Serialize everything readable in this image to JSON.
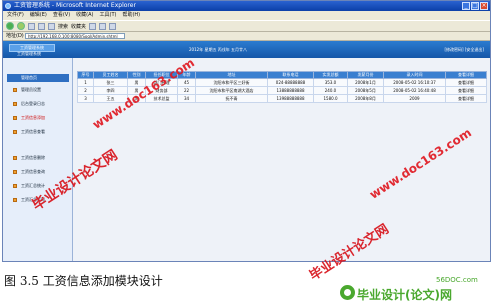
{
  "window": {
    "title": "工资管理系统 - Microsoft Internet Explorer",
    "controls": [
      "_",
      "□",
      "×"
    ]
  },
  "menu": [
    "文件(F)",
    "编辑(E)",
    "查看(V)",
    "收藏(A)",
    "工具(T)",
    "帮助(H)"
  ],
  "toolbar": {
    "search": "搜索",
    "favorites": "收藏夹"
  },
  "address": {
    "label": "地址(D)",
    "url": "http://192.168.0.100:8080/Sogl/Admin.shtml"
  },
  "app": {
    "logo": "工资管理系统",
    "subtitle": "工资管理系统",
    "date": "2012年 星期五 丙戌年 五月廿八",
    "user": "[修改密码] [安全退出]"
  },
  "sidebar": {
    "header": "管理首页",
    "items": [
      "管理员设置",
      "后台登录日志",
      "工资信息添加",
      "工资信息查看",
      "工资信息删除",
      "工资信息查询",
      "工资汇总统计",
      "工资汇总打印"
    ]
  },
  "table": {
    "headers": [
      "序号",
      "员工姓名",
      "性别",
      "担任职位",
      "年龄",
      "地址",
      "联系电话",
      "实发总额",
      "发薪月份",
      "录入时间",
      "查看详细"
    ],
    "rows": [
      [
        "1",
        "张三",
        "男",
        "部门经理",
        "45",
        "沈阳市和平区三好街",
        "024-88888888",
        "353.0",
        "2008年1月",
        "2008-05-02 16:10:37",
        "查看详细"
      ],
      [
        "2",
        "李四",
        "男",
        "财务部",
        "22",
        "沈阳市和平区南湖大酒店",
        "13888888888",
        "240.0",
        "2008年5月",
        "2008-05-02 16:40:48",
        "查看详细"
      ],
      [
        "3",
        "王五",
        "男",
        "技术总监",
        "34",
        "抚不青",
        "13988888888",
        "1580.0",
        "2008年8月",
        "2009",
        "查看详细"
      ]
    ]
  },
  "caption": "图 3.5  工资信息添加模块设计",
  "watermarks": {
    "text": "毕业设计论文网",
    "url": "www.doc163.com"
  },
  "brand": {
    "name": "毕业设计(论文)网",
    "site": "56DOC.com"
  }
}
